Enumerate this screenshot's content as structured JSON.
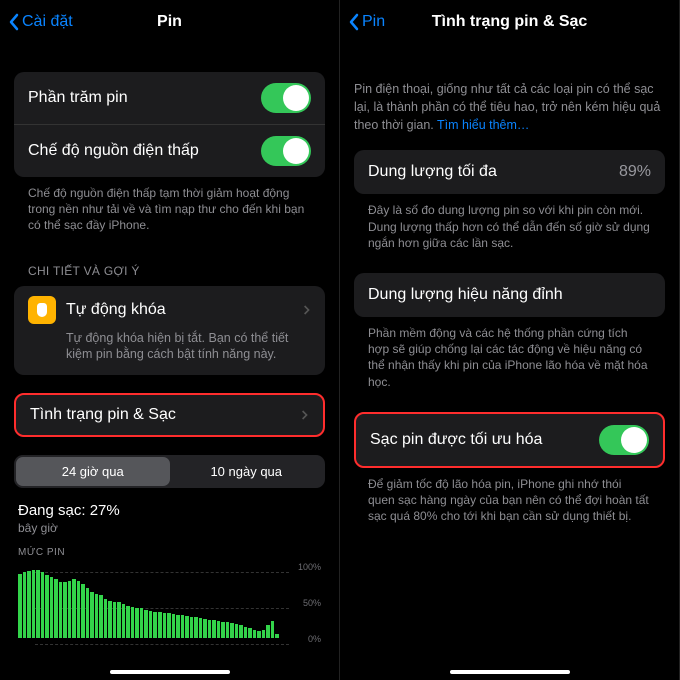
{
  "left": {
    "nav": {
      "back": "Cài đặt",
      "title": "Pin"
    },
    "battery_percent_label": "Phần trăm pin",
    "low_power_label": "Chế độ nguồn điện thấp",
    "low_power_footer": "Chế độ nguồn điện thấp tạm thời giảm hoạt động trong nền như tải về và tìm nạp thư cho đến khi bạn có thể sạc đầy iPhone.",
    "suggestions_header": "CHI TIẾT VÀ GỢI Ý",
    "tip_title": "Tự động khóa",
    "tip_sub": "Tự động khóa hiện bị tắt. Bạn có thể tiết kiệm pin bằng cách bật tính năng này.",
    "battery_health_label": "Tình trạng pin & Sạc",
    "seg": {
      "a": "24 giờ qua",
      "b": "10 ngày qua"
    },
    "charging_title": "Đang sạc: 27%",
    "charging_sub": "bây giờ",
    "chart_header": "MỨC PIN"
  },
  "right": {
    "nav": {
      "back": "Pin",
      "title": "Tình trạng pin & Sạc"
    },
    "intro": "Pin điện thoại, giống như tất cả các loại pin có thể sạc lại, là thành phần có thể tiêu hao, trở nên kém hiệu quả theo thời gian.",
    "intro_link": "Tìm hiểu thêm…",
    "max_capacity_label": "Dung lượng tối đa",
    "max_capacity_value": "89%",
    "max_capacity_footer": "Đây là số đo dung lượng pin so với khi pin còn mới. Dung lượng thấp hơn có thể dẫn đến số giờ sử dụng ngắn hơn giữa các lần sạc.",
    "peak_label": "Dung lượng hiệu năng đỉnh",
    "peak_footer": "Phần mềm động và các hệ thống phần cứng tích hợp sẽ giúp chống lại các tác động về hiệu năng có thể nhận thấy khi pin của iPhone lão hóa về mặt hóa học.",
    "optimized_label": "Sạc pin được tối ưu hóa",
    "optimized_footer": "Để giảm tốc độ lão hóa pin, iPhone ghi nhớ thói quen sạc hàng ngày của bạn nên có thể đợi hoàn tất sạc quá 80% cho tới khi bạn cần sử dụng thiết bị."
  },
  "toggle_on": true,
  "chart_data": {
    "type": "area",
    "title": "MỨC PIN",
    "ylabel": "",
    "ylim": [
      0,
      100
    ],
    "ticks": [
      0,
      50,
      100
    ],
    "values": [
      90,
      92,
      94,
      95,
      95,
      92,
      88,
      85,
      82,
      78,
      78,
      80,
      82,
      80,
      75,
      70,
      65,
      62,
      60,
      55,
      52,
      50,
      50,
      48,
      45,
      43,
      42,
      42,
      40,
      38,
      36,
      36,
      35,
      35,
      34,
      33,
      32,
      31,
      30,
      29,
      28,
      27,
      26,
      25,
      24,
      23,
      22,
      21,
      20,
      18,
      16,
      14,
      12,
      10,
      12,
      18,
      24,
      6
    ]
  }
}
